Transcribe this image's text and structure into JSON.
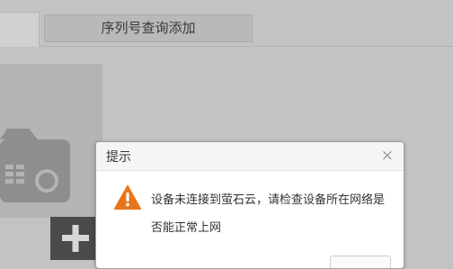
{
  "tabs": {
    "serial_lookup_add": "序列号查询添加"
  },
  "dialog": {
    "title": "提示",
    "close_glyph": "×",
    "message": "设备未连接到萤石云，请检查设备所在网络是否能正常上网"
  },
  "icons": {
    "warning": "warning-triangle-icon",
    "device": "dvr-device-icon",
    "add": "plus-icon"
  },
  "colors": {
    "warning": "#e8751a",
    "overlay": "#c3c3c3",
    "dialog_bg": "#ffffff"
  }
}
